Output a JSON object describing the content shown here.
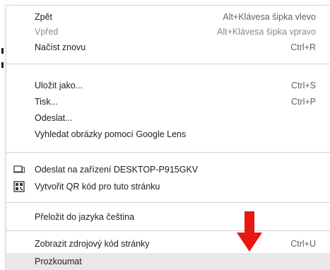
{
  "colors": {
    "arrow": "#e8170f",
    "highlight": "#e8e8e8"
  },
  "menu": {
    "items": [
      {
        "label": "Zpět",
        "shortcut": "Alt+Klávesa šipka vlevo",
        "disabled": false
      },
      {
        "label": "Vpřed",
        "shortcut": "Alt+Klávesa šipka vpravo",
        "disabled": true
      },
      {
        "label": "Načíst znovu",
        "shortcut": "Ctrl+R",
        "disabled": false
      },
      {
        "label": "Uložit jako...",
        "shortcut": "Ctrl+S",
        "disabled": false
      },
      {
        "label": "Tisk...",
        "shortcut": "Ctrl+P",
        "disabled": false
      },
      {
        "label": "Odeslat...",
        "shortcut": "",
        "disabled": false
      },
      {
        "label": "Vyhledat obrázky pomocí Google Lens",
        "shortcut": "",
        "disabled": false
      },
      {
        "label": "Odeslat na zařízení DESKTOP-P915GKV",
        "shortcut": "",
        "icon": "device-send-icon",
        "disabled": false
      },
      {
        "label": "Vytvořit QR kód pro tuto stránku",
        "shortcut": "",
        "icon": "qr-code-icon",
        "disabled": false
      },
      {
        "label": "Přeložit do jazyka čeština",
        "shortcut": "",
        "disabled": false
      },
      {
        "label": "Zobrazit zdrojový kód stránky",
        "shortcut": "Ctrl+U",
        "disabled": false
      },
      {
        "label": "Prozkoumat",
        "shortcut": "",
        "disabled": false,
        "highlighted": true
      }
    ]
  },
  "annotation": {
    "icon": "red-down-arrow-icon"
  }
}
